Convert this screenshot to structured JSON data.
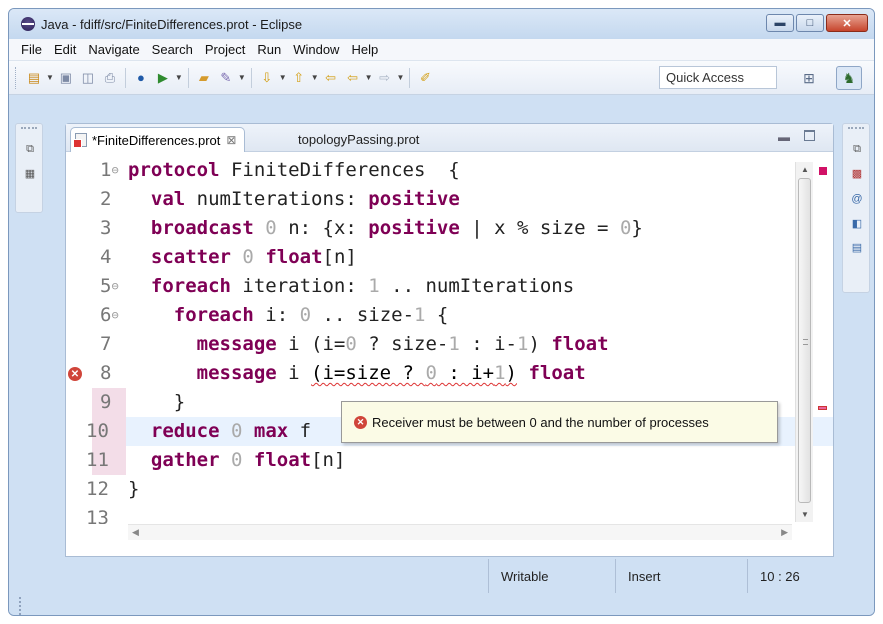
{
  "window": {
    "title": "Java - fdiff/src/FiniteDifferences.prot - Eclipse",
    "buttons": {
      "minimize": "▬",
      "maximize": "□",
      "close": "✕"
    }
  },
  "menu": [
    "File",
    "Edit",
    "Navigate",
    "Search",
    "Project",
    "Run",
    "Window",
    "Help"
  ],
  "toolbar": {
    "quick_access": "Quick Access",
    "icons": [
      "new-icon",
      "save-icon",
      "save-all-icon",
      "print-icon",
      "debug-icon",
      "run-icon",
      "open-folder-icon",
      "search-icon",
      "next-annotation-icon",
      "prev-annotation-icon",
      "last-edit-icon",
      "back-icon",
      "forward-icon",
      "pin-icon"
    ]
  },
  "editor": {
    "tabs": [
      {
        "label": "*FiniteDifferences.prot",
        "active": true,
        "close": "⊠"
      },
      {
        "label": "topologyPassing.prot",
        "active": false
      }
    ],
    "lines": [
      {
        "n": "1",
        "fold": "⊖",
        "code": [
          [
            "kw",
            "protocol"
          ],
          [
            "op",
            " FiniteDifferences  {"
          ]
        ]
      },
      {
        "n": "2",
        "code": [
          [
            "op",
            "  "
          ],
          [
            "kw",
            "val"
          ],
          [
            "op",
            " numIterations: "
          ],
          [
            "kw",
            "positive"
          ]
        ]
      },
      {
        "n": "3",
        "code": [
          [
            "op",
            "  "
          ],
          [
            "kw",
            "broadcast"
          ],
          [
            "op",
            " "
          ],
          [
            "num",
            "0"
          ],
          [
            "op",
            " n: {x: "
          ],
          [
            "kw",
            "positive"
          ],
          [
            "op",
            " | x % size = "
          ],
          [
            "num",
            "0"
          ],
          [
            "op",
            "}"
          ]
        ]
      },
      {
        "n": "4",
        "code": [
          [
            "op",
            "  "
          ],
          [
            "kw",
            "scatter"
          ],
          [
            "op",
            " "
          ],
          [
            "num",
            "0"
          ],
          [
            "op",
            " "
          ],
          [
            "kw",
            "float"
          ],
          [
            "op",
            "[n]"
          ]
        ]
      },
      {
        "n": "5",
        "fold": "⊖",
        "code": [
          [
            "op",
            "  "
          ],
          [
            "kw",
            "foreach"
          ],
          [
            "op",
            " iteration: "
          ],
          [
            "num",
            "1"
          ],
          [
            "op",
            " .. numIterations"
          ]
        ]
      },
      {
        "n": "6",
        "fold": "⊖",
        "code": [
          [
            "op",
            "    "
          ],
          [
            "kw",
            "foreach"
          ],
          [
            "op",
            " i: "
          ],
          [
            "num",
            "0"
          ],
          [
            "op",
            " .. size-"
          ],
          [
            "num",
            "1"
          ],
          [
            "op",
            " {"
          ]
        ]
      },
      {
        "n": "7",
        "code": [
          [
            "op",
            "      "
          ],
          [
            "kw",
            "message"
          ],
          [
            "op",
            " i (i="
          ],
          [
            "num",
            "0"
          ],
          [
            "op",
            " ? size-"
          ],
          [
            "num",
            "1"
          ],
          [
            "op",
            " : i-"
          ],
          [
            "num",
            "1"
          ],
          [
            "op",
            ") "
          ],
          [
            "kw",
            "float"
          ]
        ]
      },
      {
        "n": "8",
        "error": true,
        "code": [
          [
            "op",
            "      "
          ],
          [
            "kw",
            "message"
          ],
          [
            "op",
            " i "
          ],
          [
            "sq",
            "(i=size ? "
          ],
          [
            "sqnum",
            "0"
          ],
          [
            "sq",
            " : i+"
          ],
          [
            "sqnum",
            "1"
          ],
          [
            "sq",
            ")"
          ],
          [
            "op",
            " "
          ],
          [
            "kw",
            "float"
          ]
        ]
      },
      {
        "n": "9",
        "code": [
          [
            "op",
            "    }"
          ]
        ]
      },
      {
        "n": "10",
        "highlight": true,
        "code": [
          [
            "op",
            "  "
          ],
          [
            "kw",
            "reduce"
          ],
          [
            "op",
            " "
          ],
          [
            "num",
            "0"
          ],
          [
            "op",
            " "
          ],
          [
            "kw",
            "max"
          ],
          [
            "op",
            " f"
          ]
        ]
      },
      {
        "n": "11",
        "code": [
          [
            "op",
            "  "
          ],
          [
            "kw",
            "gather"
          ],
          [
            "op",
            " "
          ],
          [
            "num",
            "0"
          ],
          [
            "op",
            " "
          ],
          [
            "kw",
            "float"
          ],
          [
            "op",
            "[n]"
          ]
        ]
      },
      {
        "n": "12",
        "code": [
          [
            "op",
            "}"
          ]
        ]
      },
      {
        "n": "13",
        "code": []
      }
    ],
    "tooltip": "Receiver must be between 0 and the number of processes"
  },
  "status": {
    "writable": "Writable",
    "mode": "Insert",
    "position": "10 : 26"
  },
  "colors": {
    "keyword": "#7f0055",
    "number": "#aaaaaa",
    "error": "#d0453a",
    "tooltip_bg": "#fbfbe6"
  }
}
